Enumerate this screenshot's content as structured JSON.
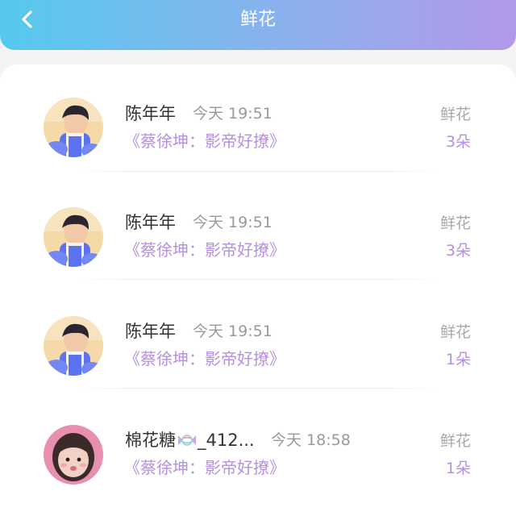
{
  "header": {
    "title": "鲜花",
    "back_icon": "chevron-left-icon",
    "gradient": [
      "#55c9ee",
      "#b399ea"
    ]
  },
  "records": [
    {
      "name": "陈年年",
      "time": "今天 19:51",
      "drama": "《蔡徐坤：影帝好撩》",
      "gift_type": "鲜花",
      "gift_count": "3朵",
      "avatar": "boy-avatar"
    },
    {
      "name": "陈年年",
      "time": "今天 19:51",
      "drama": "《蔡徐坤：影帝好撩》",
      "gift_type": "鲜花",
      "gift_count": "3朵",
      "avatar": "boy-avatar"
    },
    {
      "name": "陈年年",
      "time": "今天 19:51",
      "drama": "《蔡徐坤：影帝好撩》",
      "gift_type": "鲜花",
      "gift_count": "1朵",
      "avatar": "boy-avatar"
    },
    {
      "name": "棉花糖",
      "name_icon": "candy-icon",
      "name_suffix": "_412...",
      "time": "今天 18:58",
      "drama": "《蔡徐坤：影帝好撩》",
      "gift_type": "鲜花",
      "gift_count": "1朵",
      "avatar": "girl-avatar"
    }
  ],
  "colors": {
    "accent_purple": "#b590e0",
    "muted_text": "#9a9a9a"
  }
}
